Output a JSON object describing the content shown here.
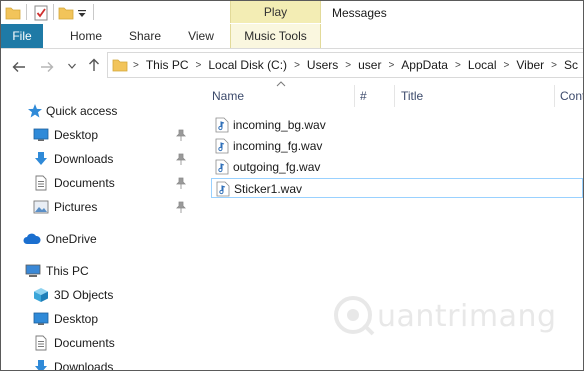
{
  "title_bar": {
    "contextual_tab_label": "Play",
    "window_title": "Messages"
  },
  "ribbon_tabs": {
    "file": "File",
    "home": "Home",
    "share": "Share",
    "view": "View",
    "music_tools": "Music Tools"
  },
  "address_bar": {
    "crumbs": [
      "This PC",
      "Local Disk (C:)",
      "Users",
      "user",
      "AppData",
      "Local",
      "Viber",
      "Sc"
    ]
  },
  "nav_pane": {
    "quick_access": "Quick access",
    "qa_items": [
      "Desktop",
      "Downloads",
      "Documents",
      "Pictures"
    ],
    "onedrive": "OneDrive",
    "this_pc": "This PC",
    "pc_items": [
      "3D Objects",
      "Desktop",
      "Documents",
      "Downloads"
    ]
  },
  "columns": {
    "name": "Name",
    "number": "#",
    "title": "Title",
    "contributing": "Cont"
  },
  "files": [
    {
      "name": "incoming_bg.wav",
      "selected": false
    },
    {
      "name": "incoming_fg.wav",
      "selected": false
    },
    {
      "name": "outgoing_fg.wav",
      "selected": false
    },
    {
      "name": "Sticker1.wav",
      "selected": true
    }
  ],
  "watermark": {
    "text": "uantrimang",
    "icon": "quantrimang-logo"
  },
  "colors": {
    "file_tab": "#1f7aa6",
    "contextual_tab": "#f3edb4",
    "selection_border": "#99d1ff",
    "column_header_text": "#3c4a6b"
  }
}
